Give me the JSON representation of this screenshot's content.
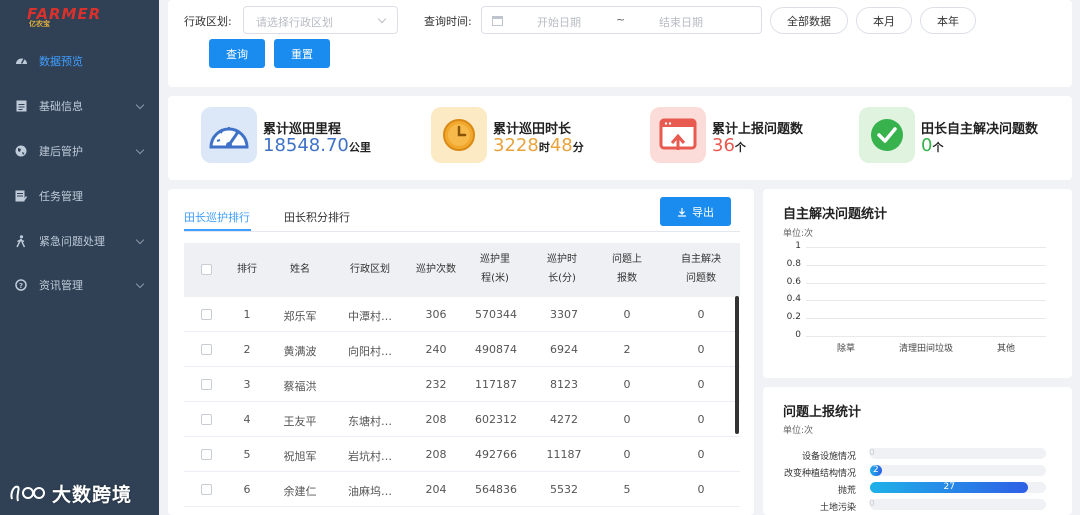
{
  "brand": {
    "name": "FARMER",
    "sub": "亿农宝"
  },
  "sidebar": {
    "items": [
      {
        "label": "数据预览",
        "icon": "dashboard-icon",
        "active": true,
        "expandable": false
      },
      {
        "label": "基础信息",
        "icon": "document-icon",
        "active": false,
        "expandable": true
      },
      {
        "label": "建后管护",
        "icon": "globe-icon",
        "active": false,
        "expandable": true
      },
      {
        "label": "任务管理",
        "icon": "task-icon",
        "active": false,
        "expandable": false
      },
      {
        "label": "紧急问题处理",
        "icon": "person-walk-icon",
        "active": false,
        "expandable": true
      },
      {
        "label": "资讯管理",
        "icon": "question-circle-icon",
        "active": false,
        "expandable": true
      }
    ]
  },
  "filter": {
    "region_label": "行政区划:",
    "region_placeholder": "请选择行政区划",
    "time_label": "查询时间:",
    "start_placeholder": "开始日期",
    "range_separator": "~",
    "end_placeholder": "结束日期",
    "quick": [
      "全部数据",
      "本月",
      "本年"
    ],
    "query_label": "查询",
    "reset_label": "重置"
  },
  "stats": [
    {
      "title": "累计巡田里程",
      "value": "18548.70",
      "unit": "公里",
      "color": "#3f72c7",
      "icon": "speedometer-icon"
    },
    {
      "title": "累计巡田时长",
      "value1": "3228",
      "unit1": "时",
      "value2": "48",
      "unit2": "分",
      "color": "#e8a33c",
      "icon": "clock-icon"
    },
    {
      "title": "累计上报问题数",
      "value": "36",
      "unit": "个",
      "color": "#e85a4f",
      "icon": "upload-window-icon"
    },
    {
      "title": "田长自主解决问题数",
      "value": "0",
      "unit": "个",
      "color": "#37b24d",
      "icon": "check-circle-icon"
    }
  ],
  "ranking": {
    "tabs": [
      "田长巡护排行",
      "田长积分排行"
    ],
    "active_tab": 0,
    "export_label": "导出",
    "columns": [
      "排行",
      "姓名",
      "行政区划",
      "巡护次数",
      "巡护里程(米)",
      "巡护时长(分)",
      "问题上报数",
      "自主解决问题数"
    ],
    "rows": [
      {
        "rank": "1",
        "name": "郑乐军",
        "region": "中潭村…",
        "count": "306",
        "distance": "570344",
        "duration": "3307",
        "reported": "0",
        "solved": "0"
      },
      {
        "rank": "2",
        "name": "黄满波",
        "region": "向阳村…",
        "count": "240",
        "distance": "490874",
        "duration": "6924",
        "reported": "2",
        "solved": "0"
      },
      {
        "rank": "3",
        "name": "蔡福洪",
        "region": "",
        "count": "232",
        "distance": "117187",
        "duration": "8123",
        "reported": "0",
        "solved": "0"
      },
      {
        "rank": "4",
        "name": "王友平",
        "region": "东塘村…",
        "count": "208",
        "distance": "602312",
        "duration": "4272",
        "reported": "0",
        "solved": "0"
      },
      {
        "rank": "5",
        "name": "祝旭军",
        "region": "岩坑村…",
        "count": "208",
        "distance": "492766",
        "duration": "11187",
        "reported": "0",
        "solved": "0"
      },
      {
        "rank": "6",
        "name": "余建仁",
        "region": "油麻坞…",
        "count": "204",
        "distance": "564836",
        "duration": "5532",
        "reported": "5",
        "solved": "0"
      }
    ]
  },
  "self_solved_chart": {
    "title": "自主解决问题统计",
    "unit": "单位:次"
  },
  "report_chart": {
    "title": "问题上报统计",
    "unit": "单位:次"
  },
  "chart_data": [
    {
      "type": "bar",
      "title": "自主解决问题统计",
      "ylabel": "单位:次",
      "categories": [
        "除草",
        "清理田间垃圾",
        "其他"
      ],
      "values": [
        0,
        0,
        0
      ],
      "yticks": [
        "0",
        "0.2",
        "0.4",
        "0.6",
        "0.8",
        "1"
      ],
      "ylim": [
        0,
        1
      ],
      "grid": true
    },
    {
      "type": "bar",
      "orientation": "horizontal",
      "title": "问题上报统计",
      "xlabel": "单位:次",
      "categories": [
        "设备设施情况",
        "改变种植结构情况",
        "抛荒",
        "土地污染"
      ],
      "values": [
        0,
        2,
        27,
        0
      ],
      "xlim": [
        0,
        30
      ]
    }
  ],
  "watermark": {
    "text": "大数跨境"
  },
  "colors": {
    "sidebar": "#304156",
    "accent": "#409eff",
    "primary_button": "#1a8cf0"
  }
}
